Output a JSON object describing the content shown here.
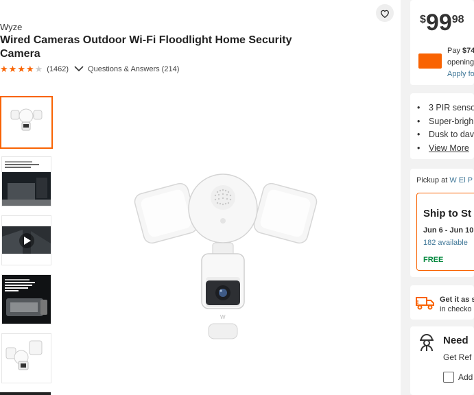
{
  "product": {
    "brand": "Wyze",
    "title": "Wired Cameras Outdoor Wi-Fi Floodlight Home Security Camera",
    "rating": 4,
    "review_count": "(1462)",
    "qa_label": "Questions & Answers (214)"
  },
  "gallery": {
    "thumb3_text": "Never forget to turn your floodlight on or off",
    "thumb5_text": "See at night, just as clear as day (even without the floodlights on)"
  },
  "price": {
    "dollar": "$",
    "integer": "99",
    "cents": "98"
  },
  "promo": {
    "line1_prefix": "Pay ",
    "line1_amount": "$74",
    "line2": "opening",
    "line3": "Apply fo"
  },
  "highlights": [
    "3 PIR senso",
    "Super-brigh",
    "Dusk to dav"
  ],
  "view_more": "View More",
  "pickup": {
    "prefix": "Pickup at ",
    "store": "W El P"
  },
  "ship": {
    "heading": "Ship to St",
    "dates": "Jun 6 - Jun 10",
    "available": "182 available",
    "cost": "FREE"
  },
  "delivery": {
    "line1": "Get it as s",
    "line2": "in checko"
  },
  "need": {
    "heading": "Need",
    "subtext": "Get Ref",
    "checkbox_label": "Add"
  },
  "colors": {
    "accent": "#f96302",
    "link": "#3e7697",
    "free": "#00873c"
  },
  "icons": [
    "heart-icon",
    "star-icon",
    "chevron-down-icon",
    "play-icon",
    "truck-icon",
    "worker-helmet-icon"
  ]
}
